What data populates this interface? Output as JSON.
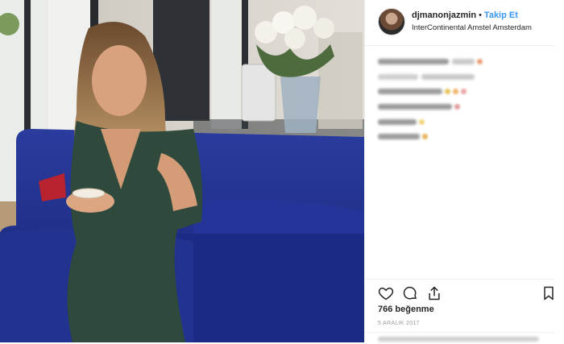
{
  "post": {
    "username": "djmanonjazmin",
    "separator": "•",
    "follow_label": "Takip Et",
    "location": "InterContinental Amstel Amsterdam",
    "likes": "766 beğenme",
    "date": "5 ARALIK 2017"
  },
  "icons": {
    "like": "heart-icon",
    "comment": "comment-icon",
    "share": "share-icon",
    "save": "bookmark-icon"
  },
  "colors": {
    "follow": "#3897f0",
    "sofa": "#1f2f8c",
    "dress": "#2f4a3d"
  }
}
